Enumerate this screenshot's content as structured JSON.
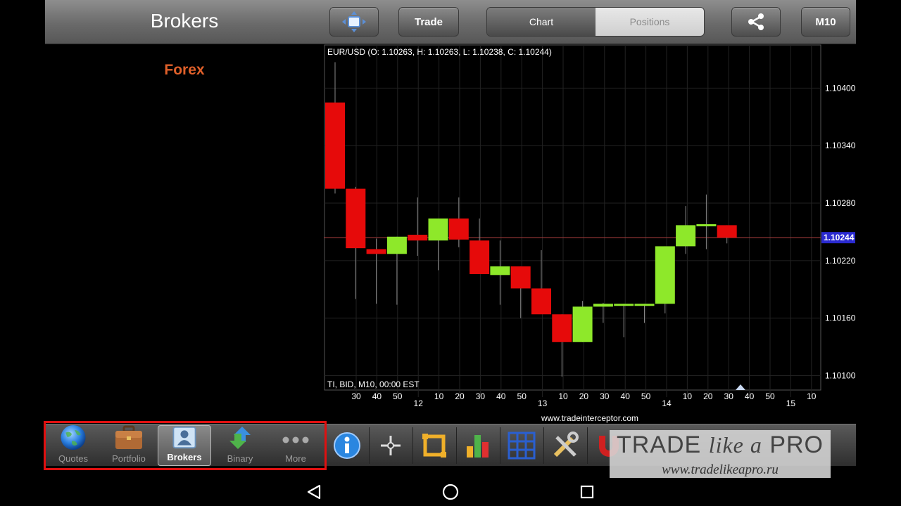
{
  "header": {
    "title": "Brokers",
    "trade_label": "Trade",
    "tabs": [
      {
        "label": "Chart",
        "active": true
      },
      {
        "label": "Positions",
        "active": false
      }
    ],
    "timeframe_label": "M10"
  },
  "left_panel": {
    "section_title": "Forex"
  },
  "chart_info": {
    "header": "EUR/USD (O: 1.10263, H: 1.10263, L: 1.10238, C: 1.10244)",
    "footer": "TI, BID, M10, 00:00 EST",
    "url": "www.tradeinterceptor.com"
  },
  "chart_data": {
    "type": "candlestick",
    "symbol": "EUR/USD",
    "timeframe": "M10",
    "ylim": [
      1.10085,
      1.10445
    ],
    "yticks": [
      "1.10400",
      "1.10340",
      "1.10280",
      "1.10220",
      "1.10160",
      "1.10100"
    ],
    "ytick_values": [
      1.104,
      1.1034,
      1.1028,
      1.1022,
      1.1016,
      1.101
    ],
    "current_price": "1.10244",
    "current_price_value": 1.10244,
    "xticks": [
      "30",
      "40",
      "50",
      "12",
      "10",
      "20",
      "30",
      "40",
      "50",
      "13",
      "10",
      "20",
      "30",
      "40",
      "50",
      "14",
      "10",
      "20",
      "30",
      "40",
      "50",
      "15",
      "10"
    ],
    "candles": [
      {
        "o": 1.10385,
        "h": 1.10427,
        "l": 1.1029,
        "c": 1.10295
      },
      {
        "o": 1.10295,
        "h": 1.10297,
        "l": 1.1018,
        "c": 1.10233
      },
      {
        "o": 1.10232,
        "h": 1.10243,
        "l": 1.10175,
        "c": 1.10227
      },
      {
        "o": 1.10227,
        "h": 1.10245,
        "l": 1.10174,
        "c": 1.10245
      },
      {
        "o": 1.10247,
        "h": 1.10286,
        "l": 1.10225,
        "c": 1.10241
      },
      {
        "o": 1.10241,
        "h": 1.10262,
        "l": 1.1021,
        "c": 1.10264
      },
      {
        "o": 1.10264,
        "h": 1.10286,
        "l": 1.10234,
        "c": 1.10242
      },
      {
        "o": 1.10241,
        "h": 1.10264,
        "l": 1.10209,
        "c": 1.10206
      },
      {
        "o": 1.10205,
        "h": 1.10241,
        "l": 1.10174,
        "c": 1.10214
      },
      {
        "o": 1.10214,
        "h": 1.10214,
        "l": 1.1016,
        "c": 1.10191
      },
      {
        "o": 1.10191,
        "h": 1.10231,
        "l": 1.10166,
        "c": 1.10164
      },
      {
        "o": 1.10164,
        "h": 1.10164,
        "l": 1.10099,
        "c": 1.10135
      },
      {
        "o": 1.10135,
        "h": 1.10178,
        "l": 1.10135,
        "c": 1.10172
      },
      {
        "o": 1.10172,
        "h": 1.10176,
        "l": 1.10155,
        "c": 1.10175
      },
      {
        "o": 1.10175,
        "h": 1.10175,
        "l": 1.1014,
        "c": 1.10175
      },
      {
        "o": 1.10175,
        "h": 1.10175,
        "l": 1.10155,
        "c": 1.10175
      },
      {
        "o": 1.10175,
        "h": 1.10235,
        "l": 1.10165,
        "c": 1.10235
      },
      {
        "o": 1.10235,
        "h": 1.10277,
        "l": 1.10227,
        "c": 1.10257
      },
      {
        "o": 1.10256,
        "h": 1.10289,
        "l": 1.10232,
        "c": 1.10258
      },
      {
        "o": 1.10257,
        "h": 1.10257,
        "l": 1.10238,
        "c": 1.10244
      }
    ],
    "grid": true
  },
  "bottom_tabs": [
    {
      "label": "Quotes",
      "icon": "globe-icon",
      "active": false
    },
    {
      "label": "Portfolio",
      "icon": "briefcase-icon",
      "active": false
    },
    {
      "label": "Brokers",
      "icon": "broker-icon",
      "active": true
    },
    {
      "label": "Binary",
      "icon": "binary-arrows-icon",
      "active": false
    },
    {
      "label": "More",
      "icon": "more-dots-icon",
      "active": false
    }
  ],
  "toolbar": [
    {
      "icon": "info-icon"
    },
    {
      "icon": "crosshair-icon"
    },
    {
      "icon": "zoom-frame-icon"
    },
    {
      "icon": "indicators-icon"
    },
    {
      "icon": "grid-icon"
    },
    {
      "icon": "tools-icon"
    },
    {
      "icon": "magnet-icon"
    },
    {
      "icon": "draw-icon"
    },
    {
      "icon": "alert-icon"
    },
    {
      "icon": "sound-icon"
    }
  ],
  "watermark": {
    "title_a": "TRADE ",
    "title_b": "like a",
    "title_c": " PRO",
    "url": "www.tradelikeapro.ru"
  },
  "colors": {
    "up": "#8ee82a",
    "down": "#e60a0a",
    "grid": "#222222",
    "price_line": "#b04040",
    "accent": "#e0602a"
  }
}
